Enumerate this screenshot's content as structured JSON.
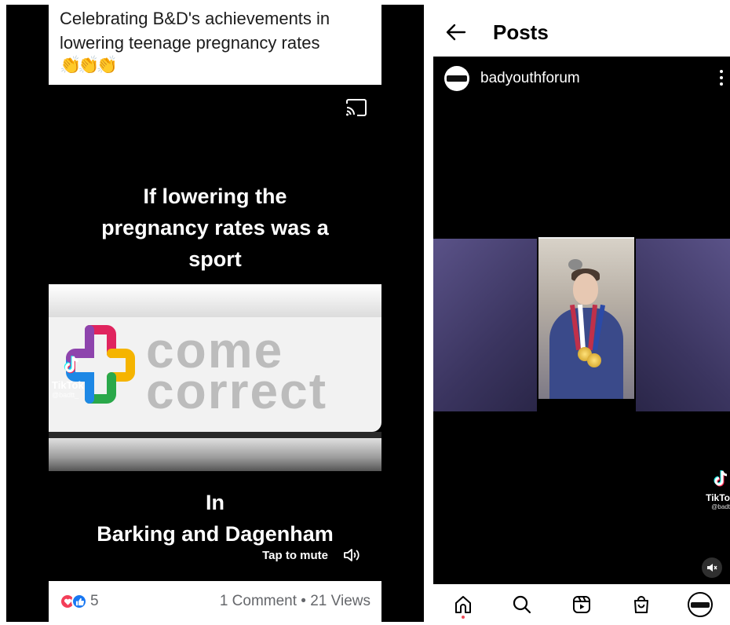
{
  "facebook_post": {
    "caption_line1": "Celebrating B&D's achievements in",
    "caption_line2": "lowering  teenage pregnancy rates",
    "caption_emoji": "👏👏👏",
    "video": {
      "headline_line1": "If lowering the",
      "headline_line2": "pregnancy rates was a",
      "headline_line3": "sport",
      "logo_word1": "come",
      "logo_word2": "correct",
      "tiktok_label": "TikTok",
      "tiktok_handle": "@badtt_",
      "in_line1": "In",
      "in_line2": "Barking and Dagenham",
      "mute_label": "Tap to mute"
    },
    "reaction_count": "5",
    "stats": "1 Comment • 21 Views",
    "icons": [
      "cast-icon",
      "speaker-icon",
      "love-reaction-icon",
      "like-reaction-icon"
    ]
  },
  "instagram_post": {
    "page_title": "Posts",
    "author": "badyouthforum",
    "tiktok_label": "TikTo",
    "tiktok_handle": "@badt",
    "icons": [
      "back-arrow-icon",
      "more-icon",
      "muted-speaker-icon",
      "home-icon",
      "search-icon",
      "reels-icon",
      "shop-icon",
      "profile-avatar"
    ]
  },
  "colors": {
    "facebook_like": "#1877f2",
    "facebook_love": "#f33e58",
    "instagram_notification": "#ed4956"
  }
}
